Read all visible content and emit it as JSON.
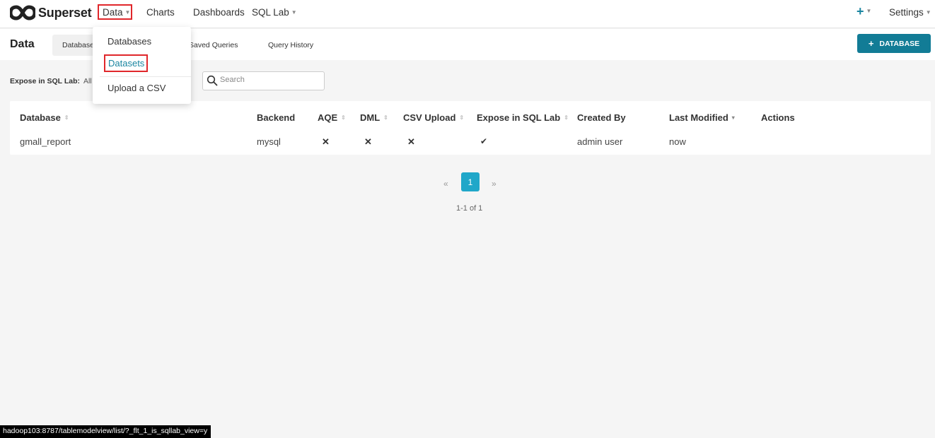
{
  "navbar": {
    "brand": "Superset",
    "items": [
      {
        "label": "Data"
      },
      {
        "label": "Charts"
      },
      {
        "label": "Dashboards"
      },
      {
        "label": "SQL Lab"
      }
    ],
    "settings_label": "Settings",
    "plus_label": "+"
  },
  "subheader": {
    "title": "Data",
    "tabs": [
      {
        "label": "Databases",
        "active": true
      },
      {
        "label": "Saved Queries"
      },
      {
        "label": "Query History"
      }
    ],
    "add_button": {
      "icon": "+",
      "label": "DATABASE"
    }
  },
  "filters": {
    "expose_label": "Expose in SQL Lab:",
    "expose_value": "All",
    "search_placeholder": "Search"
  },
  "table": {
    "columns": [
      "Database",
      "Backend",
      "AQE",
      "DML",
      "CSV Upload",
      "Expose in SQL Lab",
      "Created By",
      "Last Modified",
      "Actions"
    ],
    "rows": [
      {
        "database": "gmall_report",
        "backend": "mysql",
        "aqe": "✕",
        "dml": "✕",
        "csv_upload": "✕",
        "expose_in_sql_lab": "✔",
        "created_by": "admin user",
        "last_modified": "now",
        "actions": ""
      }
    ]
  },
  "pagination": {
    "prev": "«",
    "current_page": "1",
    "next": "»",
    "count_text": "1-1 of 1"
  },
  "dropdown": {
    "items": [
      {
        "label": "Databases"
      },
      {
        "label": "Datasets",
        "highlighted": true
      },
      {
        "label": "Upload a CSV"
      }
    ]
  },
  "statusbar": {
    "url": "hadoop103:8787/tablemodelview/list/?_flt_1_is_sqllab_view=y"
  },
  "colors": {
    "accent": "#127c96",
    "page_active": "#20a7c9",
    "highlight_border": "#e0272b",
    "link": "#1a85a0"
  }
}
